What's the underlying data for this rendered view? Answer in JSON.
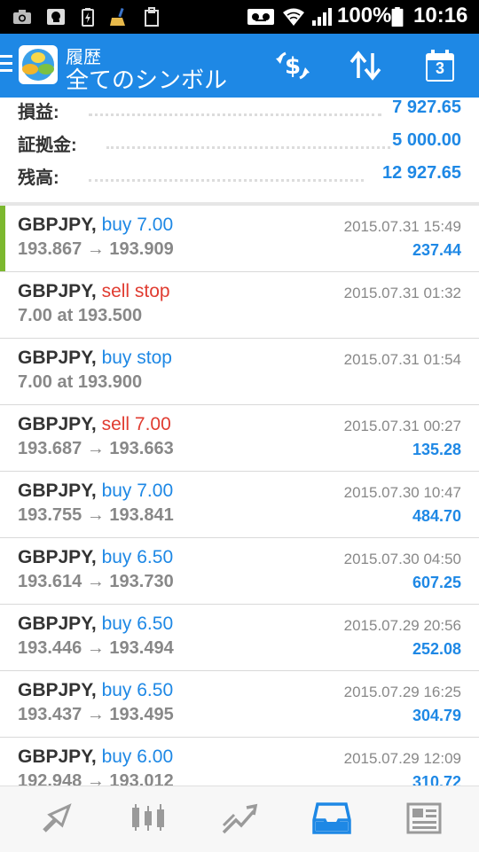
{
  "status_bar": {
    "battery": "100%",
    "time": "10:16",
    "icons": [
      "camera-icon",
      "mail-icon",
      "battery-charging-icon",
      "broom-icon",
      "clipboard-icon",
      "voicemail-icon",
      "wifi-icon",
      "signal-icon",
      "battery-icon"
    ]
  },
  "app_bar": {
    "subtitle": "履歴",
    "title": "全てのシンボル",
    "calendar_day": "3",
    "icons": [
      "menu-icon",
      "app-logo-icon",
      "currency-exchange-icon",
      "sort-icon",
      "calendar-icon"
    ]
  },
  "summary": {
    "profit_label": "損益:",
    "profit_value": "7 927.65",
    "deposit_label": "証拠金:",
    "deposit_value": "5 000.00",
    "balance_label": "残高:",
    "balance_value": "12 927.65"
  },
  "trades": [
    {
      "symbol": "GBPJPY,",
      "type": "buy 7.00",
      "side": "buy",
      "prices": "193.867 → 193.909",
      "time": "2015.07.31 15:49",
      "profit": "237.44"
    },
    {
      "symbol": "GBPJPY,",
      "type": "sell stop",
      "side": "sell",
      "prices": "7.00 at 193.500",
      "time": "2015.07.31 01:32",
      "profit": ""
    },
    {
      "symbol": "GBPJPY,",
      "type": "buy stop",
      "side": "buy",
      "prices": "7.00 at 193.900",
      "time": "2015.07.31 01:54",
      "profit": ""
    },
    {
      "symbol": "GBPJPY,",
      "type": "sell 7.00",
      "side": "sell",
      "prices": "193.687 → 193.663",
      "time": "2015.07.31 00:27",
      "profit": "135.28"
    },
    {
      "symbol": "GBPJPY,",
      "type": "buy 7.00",
      "side": "buy",
      "prices": "193.755 → 193.841",
      "time": "2015.07.30 10:47",
      "profit": "484.70"
    },
    {
      "symbol": "GBPJPY,",
      "type": "buy 6.50",
      "side": "buy",
      "prices": "193.614 → 193.730",
      "time": "2015.07.30 04:50",
      "profit": "607.25"
    },
    {
      "symbol": "GBPJPY,",
      "type": "buy 6.50",
      "side": "buy",
      "prices": "193.446 → 193.494",
      "time": "2015.07.29 20:56",
      "profit": "252.08"
    },
    {
      "symbol": "GBPJPY,",
      "type": "buy 6.50",
      "side": "buy",
      "prices": "193.437 → 193.495",
      "time": "2015.07.29 16:25",
      "profit": "304.79"
    },
    {
      "symbol": "GBPJPY,",
      "type": "buy 6.00",
      "side": "buy",
      "prices": "192.948 → 193.012",
      "time": "2015.07.29 12:09",
      "profit": "310.72"
    }
  ],
  "nav": {
    "items": [
      "quotes-icon",
      "chart-icon",
      "trade-icon",
      "history-icon",
      "news-icon"
    ],
    "active": "history-icon"
  },
  "colors": {
    "accent": "#1e88e5",
    "sell": "#e03c31",
    "selected_marker": "#7cb82f"
  }
}
